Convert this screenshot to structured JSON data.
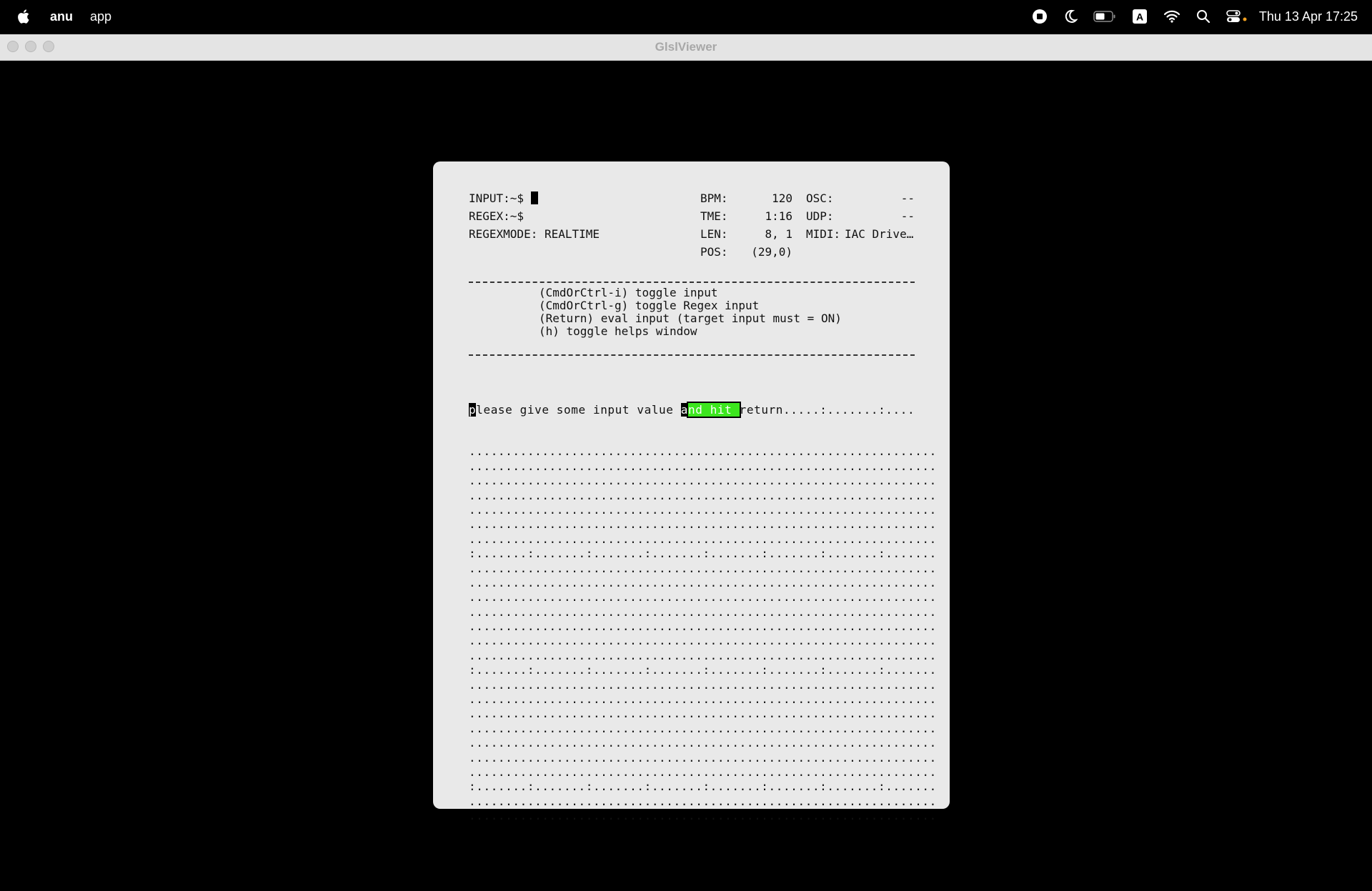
{
  "menubar": {
    "app_name": "anu",
    "menu_items": [
      "app"
    ],
    "clock": "Thu 13 Apr  17:25",
    "status_icons": [
      "screen-record-icon",
      "moon-icon",
      "battery-icon",
      "keyboard-input-a-icon",
      "wifi-icon",
      "search-icon",
      "control-center-icon"
    ]
  },
  "window": {
    "title": "GlslViewer"
  },
  "terminal": {
    "input_prompt": "INPUT:~$",
    "regex_prompt": "REGEX:~$",
    "regexmode": "REGEXMODE: REALTIME",
    "stats": {
      "bpm_label": "BPM:",
      "bpm_value": "120",
      "tme_label": "TME:",
      "tme_value": "1:16",
      "len_label": "LEN:",
      "len_value": "8, 1",
      "pos_label": "POS:",
      "pos_value": "(29,0)",
      "osc_label": "OSC:",
      "osc_value": "--",
      "udp_label": "UDP:",
      "udp_value": "--",
      "midi_label": "MIDI:",
      "midi_value": "IAC Drive…"
    },
    "help_lines": [
      "(CmdOrCtrl-i) toggle input",
      "(CmdOrCtrl-g) toggle Regex input",
      "(Return) eval input (target input must = ON)",
      "(h) toggle helps window"
    ],
    "first_line": {
      "cursor_char": "p",
      "part1": "lease give some input value ",
      "cursor_char2": "a",
      "highlight": "nd hit ",
      "part2": "return.....:.......:...."
    },
    "grid_rows": [
      "................................................................",
      "................................................................",
      "................................................................",
      "................................................................",
      "................................................................",
      "................................................................",
      "................................................................",
      ":.......:.......:.......:.......:.......:.......:.......:.......",
      "................................................................",
      "................................................................",
      "................................................................",
      "................................................................",
      "................................................................",
      "................................................................",
      "................................................................",
      ":.......:.......:.......:.......:.......:.......:.......:.......",
      "................................................................",
      "................................................................",
      "................................................................",
      "................................................................",
      "................................................................",
      "................................................................",
      "................................................................",
      ":.......:.......:.......:.......:.......:.......:.......:.......",
      "................................................................",
      "................................................................"
    ]
  }
}
